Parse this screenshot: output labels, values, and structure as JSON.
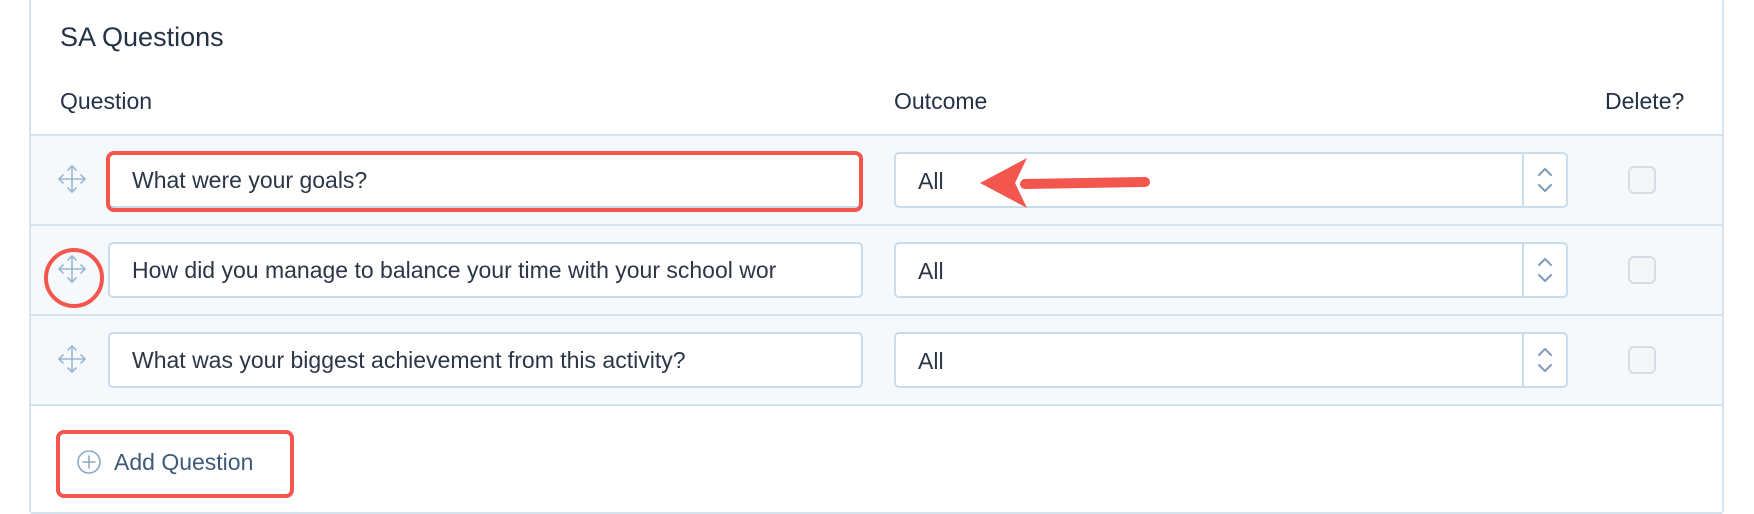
{
  "section": {
    "title": "SA Questions"
  },
  "columns": {
    "question": "Question",
    "outcome": "Outcome",
    "delete": "Delete?"
  },
  "rows": [
    {
      "question": "What were your goals?",
      "outcome": "All",
      "delete_checked": false
    },
    {
      "question": "How did you manage to balance your time with your school wor",
      "outcome": "All",
      "delete_checked": false
    },
    {
      "question": "What was your biggest achievement from this activity?",
      "outcome": "All",
      "delete_checked": false
    }
  ],
  "actions": {
    "add_question_label": "Add Question"
  },
  "icons": {
    "drag": "move-arrows-icon",
    "select": "chevron-up-down-icon",
    "add": "plus-circle-icon"
  },
  "colors": {
    "annotation": "#f2564d",
    "border": "#c9dcec",
    "text": "#243246",
    "icon": "#9bb7d4"
  }
}
